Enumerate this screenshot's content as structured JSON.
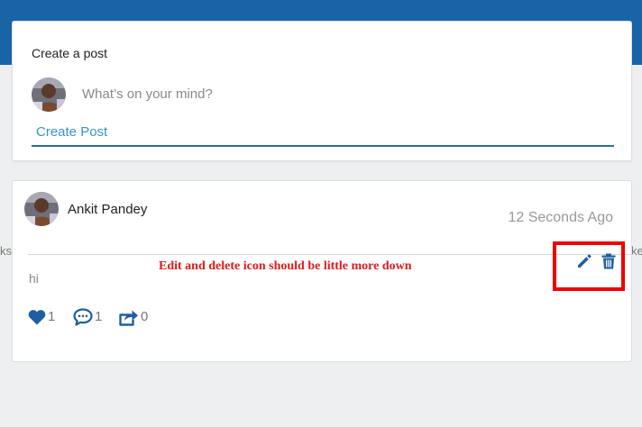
{
  "create_post": {
    "title": "Create a post",
    "placeholder": "What’s on your mind?",
    "button_label": "Create Post"
  },
  "post": {
    "author": "Ankit Pandey",
    "timestamp": "12 Seconds Ago",
    "text": "hi",
    "likes": "1",
    "comments": "1",
    "shares": "0",
    "annotation": "Edit and delete icon should be little more down"
  },
  "background_fragments": {
    "left": "ks",
    "right": "ke"
  },
  "colors": {
    "header": "#1864a6",
    "accent": "#3a93c8",
    "icon": "#1f5fa0",
    "annotation": "#e11a1a"
  }
}
